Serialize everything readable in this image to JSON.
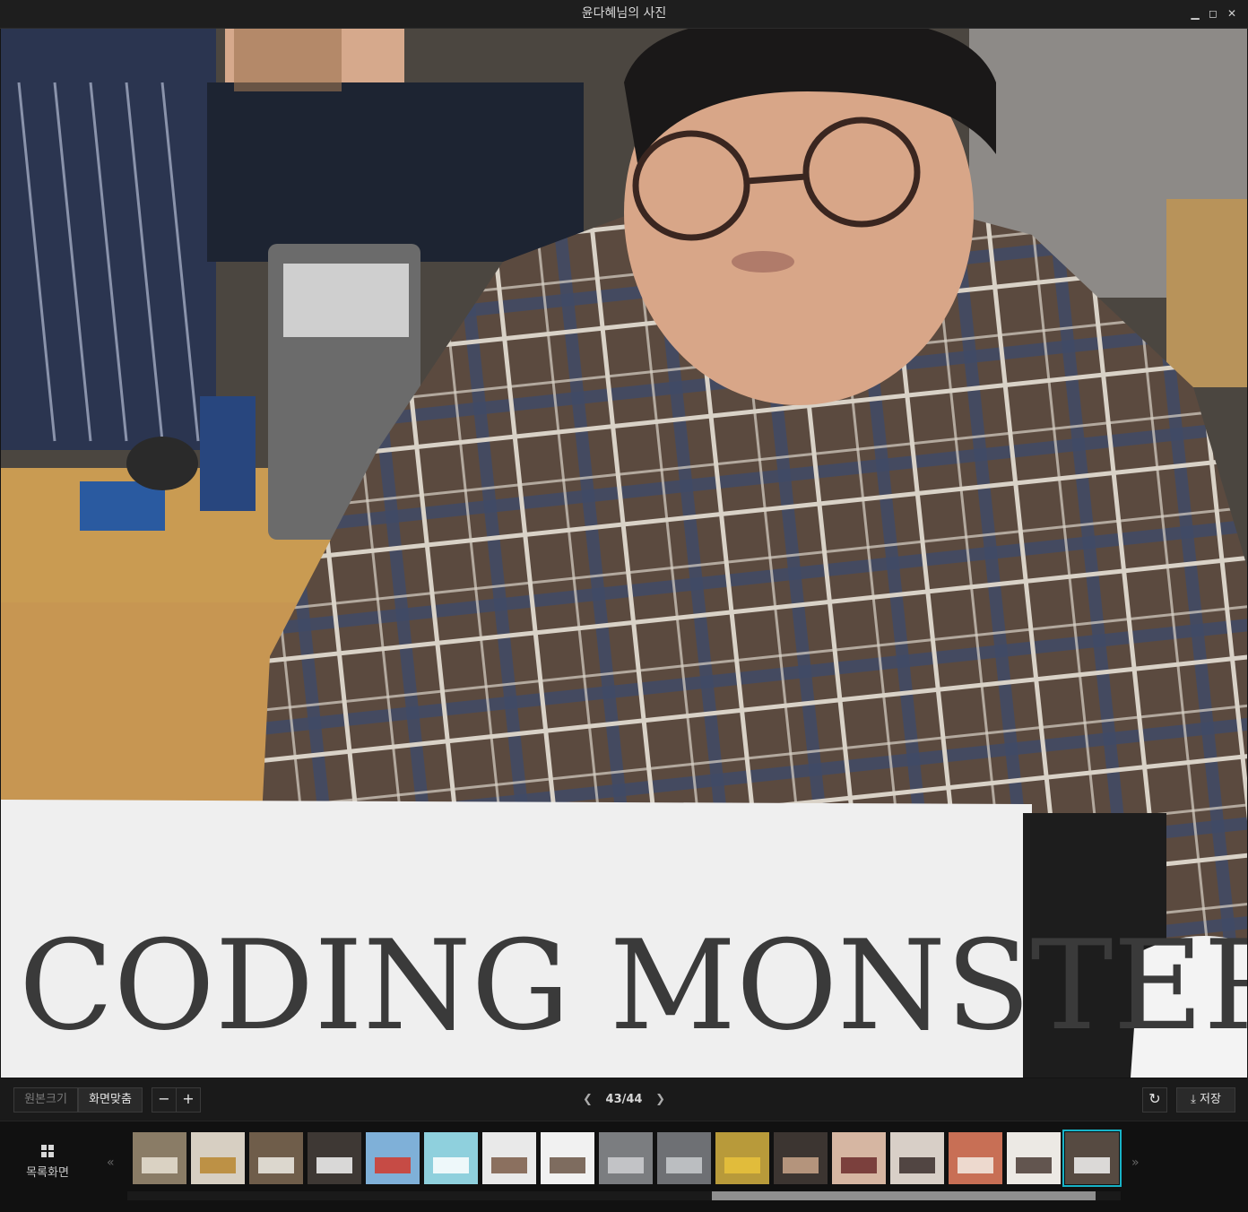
{
  "window": {
    "title": "윤다혜님의 사진",
    "controls": [
      "minimize-icon",
      "maximize-icon",
      "close-icon"
    ]
  },
  "photo": {
    "sign_text": "CODING MONSTER",
    "colors": {
      "shirt": "#5b4a3f",
      "plaid_blue": "#3f4a66",
      "plaid_white": "#d9d2c7",
      "desk": "#c99b52",
      "sign": "#efefef"
    }
  },
  "toolbar": {
    "original_size_label": "원본크기",
    "fit_screen_label": "화면맞춤",
    "zoom_out_label": "−",
    "zoom_in_label": "+",
    "pager_current": "43/44",
    "save_label": "저장",
    "rotate_icon": "rotate-icon",
    "download_icon": "download-icon"
  },
  "filmstrip": {
    "list_label": "목록화면",
    "prev_label": "«",
    "next_label": "»",
    "thumbnails": [
      {
        "id": 1,
        "color": "#8a7c66",
        "accent": "#e7e2d4"
      },
      {
        "id": 2,
        "color": "#d7cfc2",
        "accent": "#b8862f"
      },
      {
        "id": 3,
        "color": "#6f5d4a",
        "accent": "#f0ece5"
      },
      {
        "id": 4,
        "color": "#3e3834",
        "accent": "#f5f5f5"
      },
      {
        "id": 5,
        "color": "#7fb0d8",
        "accent": "#d23a2c"
      },
      {
        "id": 6,
        "color": "#8fd0dd",
        "accent": "#ffffff"
      },
      {
        "id": 7,
        "color": "#e9e9e9",
        "accent": "#7a5a46"
      },
      {
        "id": 8,
        "color": "#f1f1f1",
        "accent": "#6a5545"
      },
      {
        "id": 9,
        "color": "#7b7d80",
        "accent": "#cfcfd2"
      },
      {
        "id": 10,
        "color": "#6e7074",
        "accent": "#c9cbcf"
      },
      {
        "id": 11,
        "color": "#b89a3a",
        "accent": "#e8c23c"
      },
      {
        "id": 12,
        "color": "#3c3531",
        "accent": "#c9a58a"
      },
      {
        "id": 13,
        "color": "#d6b6a2",
        "accent": "#6b2b2b"
      },
      {
        "id": 14,
        "color": "#d8cfc7",
        "accent": "#3a2d2a"
      },
      {
        "id": 15,
        "color": "#c86f55",
        "accent": "#f3ece4"
      },
      {
        "id": 16,
        "color": "#ece9e4",
        "accent": "#4a3b35"
      },
      {
        "id": 17,
        "color": "#564a41",
        "accent": "#f2f2f2"
      }
    ],
    "selected_index": 16,
    "accent_color": "#17b3c7"
  }
}
